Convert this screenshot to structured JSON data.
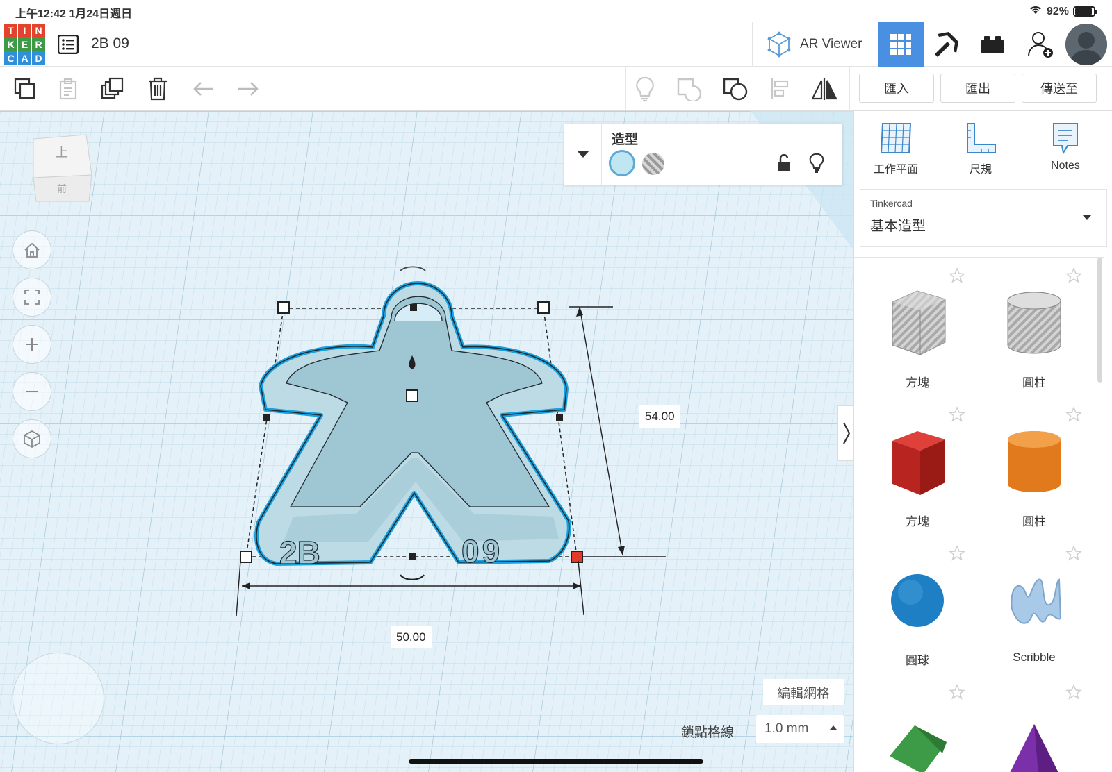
{
  "status_bar": {
    "time": "上午12:42  1月24日週日",
    "battery": "92%"
  },
  "app": {
    "logo_letters": [
      "T",
      "I",
      "N",
      "K",
      "E",
      "R",
      "C",
      "A",
      "D"
    ],
    "logo_colors": [
      "#e1432d",
      "#e1432d",
      "#e1432d",
      "#3d9a46",
      "#3d9a46",
      "#3d9a46",
      "#2f8fd8",
      "#2f8fd8",
      "#2f8fd8"
    ],
    "design_title": "2B 09",
    "ar_viewer_label": "AR Viewer"
  },
  "toolbar": {
    "import_label": "匯入",
    "export_label": "匯出",
    "send_label": "傳送至"
  },
  "viewcube": {
    "top_face": "上",
    "front_face": "前"
  },
  "shape_panel": {
    "title": "造型"
  },
  "dimensions": {
    "height": "54.00",
    "width": "50.00"
  },
  "model": {
    "text_left": "2B",
    "text_right": "09"
  },
  "grid_controls": {
    "edit_grid_label": "編輯網格",
    "snap_label": "鎖點格線",
    "snap_value": "1.0 mm"
  },
  "right_panel": {
    "tools": [
      {
        "label": "工作平面"
      },
      {
        "label": "尺規"
      },
      {
        "label": "Notes"
      }
    ],
    "library_source": "Tinkercad",
    "library_name": "基本造型",
    "shapes": [
      {
        "label": "方塊"
      },
      {
        "label": "圓柱"
      },
      {
        "label": "方塊"
      },
      {
        "label": "圓柱"
      },
      {
        "label": "圓球"
      },
      {
        "label": "Scribble"
      }
    ]
  },
  "colors": {
    "accent": "#4a90e2",
    "workplane": "#d6ecf6",
    "selection": "#1aa0dc",
    "model_fill": "#bcdbe5"
  }
}
